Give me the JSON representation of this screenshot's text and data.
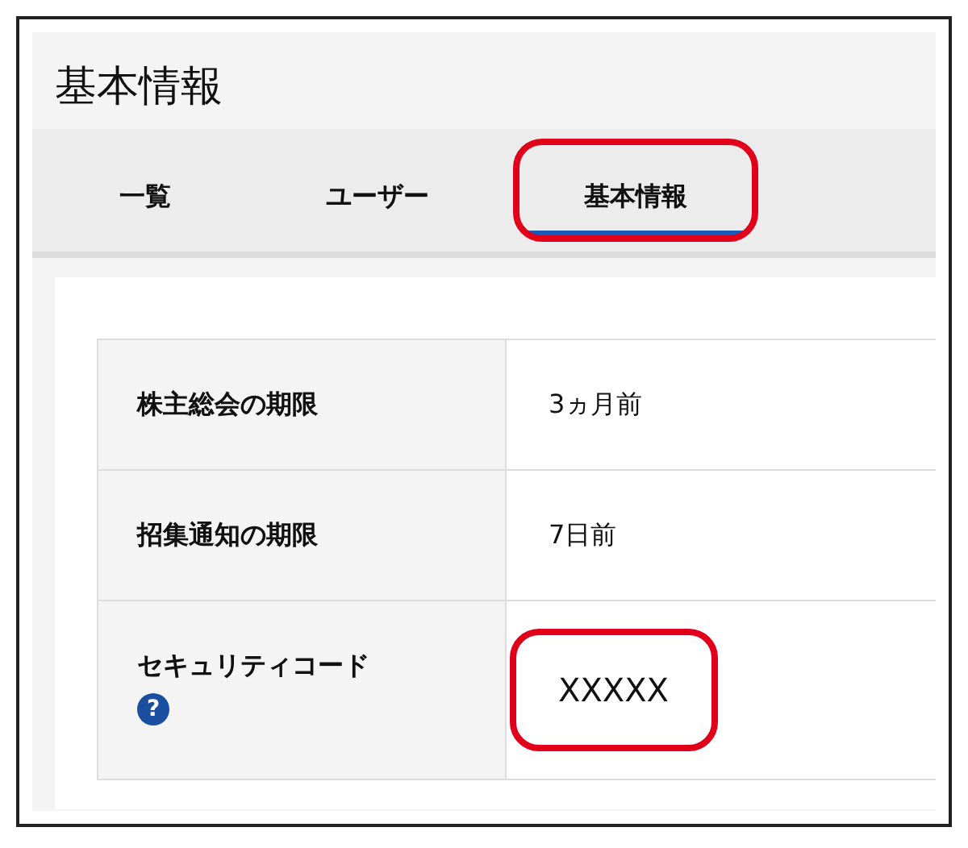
{
  "page_title": "基本情報",
  "tabs": [
    {
      "label": "一覧",
      "selected": false,
      "highlighted": false
    },
    {
      "label": "ユーザー",
      "selected": false,
      "highlighted": false
    },
    {
      "label": "基本情報",
      "selected": true,
      "highlighted": true
    }
  ],
  "rows": [
    {
      "label": "株主総会の期限",
      "value": "3ヵ月前",
      "help": "",
      "highlighted": false
    },
    {
      "label": "招集通知の期限",
      "value": "7日前",
      "help": "",
      "highlighted": false
    },
    {
      "label": "セキュリティコード",
      "value": "XXXXX",
      "help": "?",
      "highlighted": true
    }
  ]
}
